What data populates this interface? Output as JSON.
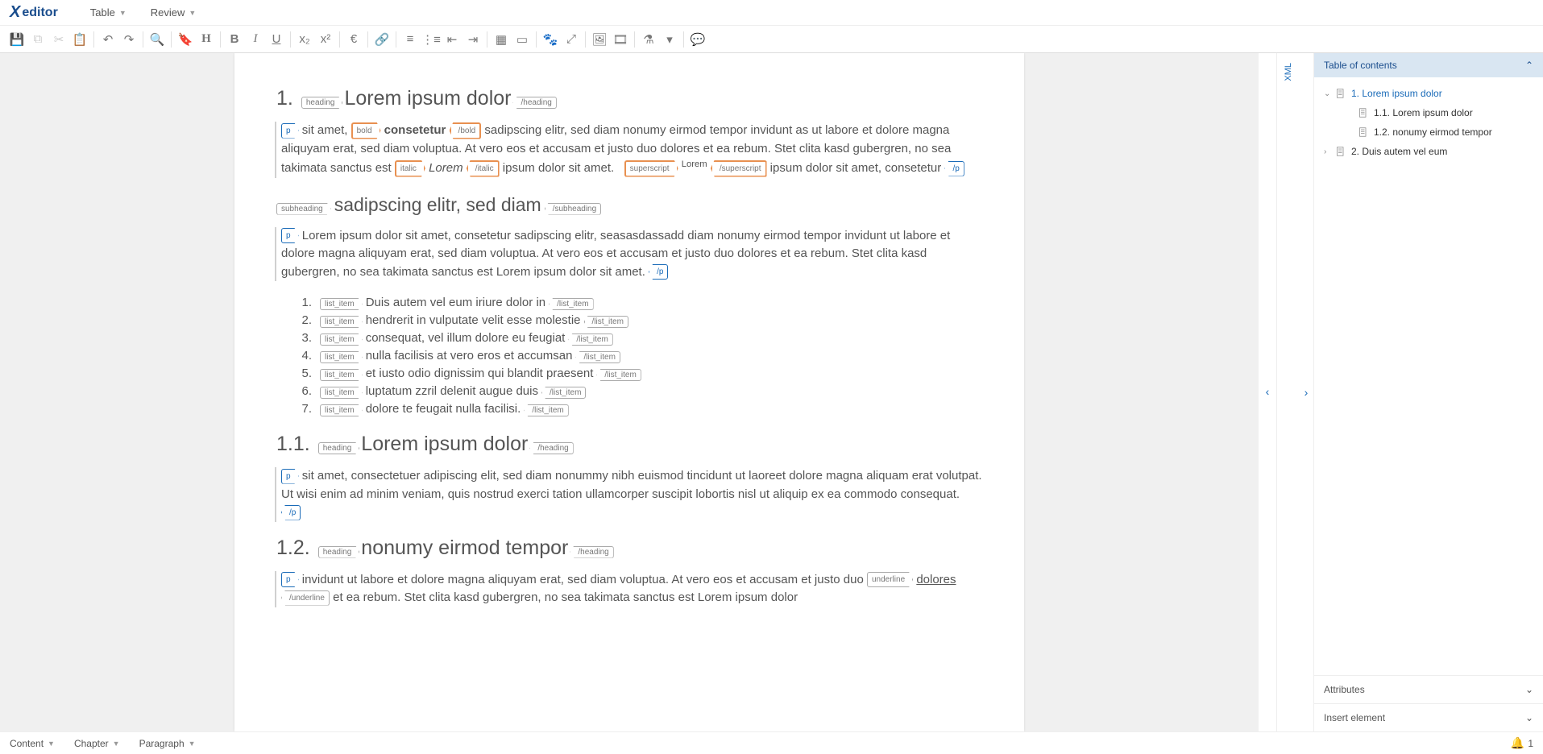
{
  "logo": {
    "prefix": "X",
    "text": "editor"
  },
  "menus": [
    {
      "label": "Table"
    },
    {
      "label": "Review"
    }
  ],
  "toolbar_groups": [
    [
      {
        "icon": "save",
        "faded": false
      },
      {
        "icon": "copy",
        "faded": true
      },
      {
        "icon": "cut",
        "faded": true
      },
      {
        "icon": "paste",
        "faded": false
      }
    ],
    [
      {
        "icon": "undo",
        "faded": false
      },
      {
        "icon": "redo",
        "faded": false
      }
    ],
    [
      {
        "icon": "search",
        "faded": false
      }
    ],
    [
      {
        "icon": "bookmark",
        "faded": false
      },
      {
        "icon": "heading",
        "faded": false
      }
    ],
    [
      {
        "icon": "bold",
        "faded": false
      },
      {
        "icon": "italic",
        "faded": false
      },
      {
        "icon": "underline",
        "faded": false
      }
    ],
    [
      {
        "icon": "subscript",
        "faded": false
      },
      {
        "icon": "superscript",
        "faded": false
      }
    ],
    [
      {
        "icon": "euro",
        "faded": false
      }
    ],
    [
      {
        "icon": "link",
        "faded": false
      }
    ],
    [
      {
        "icon": "ol",
        "faded": false
      },
      {
        "icon": "ul",
        "faded": false
      },
      {
        "icon": "indent",
        "faded": false
      },
      {
        "icon": "outdent",
        "faded": false
      }
    ],
    [
      {
        "icon": "table",
        "faded": false
      },
      {
        "icon": "rect",
        "faded": false
      }
    ],
    [
      {
        "icon": "paw",
        "faded": false
      },
      {
        "icon": "expand",
        "faded": false
      }
    ],
    [
      {
        "icon": "image",
        "faded": false
      },
      {
        "icon": "video",
        "faded": false
      }
    ],
    [
      {
        "icon": "flask",
        "faded": false
      },
      {
        "icon": "caret",
        "faded": false
      }
    ],
    [
      {
        "icon": "comment",
        "faded": false
      }
    ]
  ],
  "doc": {
    "s1": {
      "num": "1.",
      "tag": "heading",
      "title": "Lorem ipsum dolor",
      "p1": {
        "pre_bold": "sit amet,",
        "bold_tag": "bold",
        "bold_text": "consetetur",
        "after_bold": "sadipscing elitr, sed diam nonumy eirmod tempor invidunt as ut  labore et dolore magna aliquyam erat, sed diam voluptua. At vero eos et accusam et justo duo dolores et ea rebum. Stet clita kasd gubergren, no sea takimata sanctus est",
        "italic_tag": "italic",
        "italic_text": "Lorem",
        "after_italic": "ipsum dolor sit amet.",
        "sup_tag": "superscript",
        "sup_text": "Lorem",
        "after_sup": "ipsum dolor sit amet, consetetur"
      },
      "sub": {
        "tag": "subheading",
        "title": "sadipscing elitr, sed diam"
      },
      "p2": "Lorem ipsum dolor sit amet, consetetur sadipscing elitr, seasasdassadd  diam nonumy eirmod tempor invidunt ut labore et dolore magna aliquyam erat, sed diam voluptua. At vero eos et accusam et justo duo dolores et ea rebum. Stet clita kasd gubergren, no sea takimata sanctus est Lorem ipsum dolor sit amet.",
      "list_tag": "list_item",
      "list": [
        "Duis autem vel eum iriure dolor in",
        "hendrerit in vulputate velit esse molestie",
        "consequat, vel illum dolore eu feugiat",
        "nulla facilisis at vero eros et accumsan",
        "et iusto odio dignissim qui blandit praesent",
        "luptatum zzril delenit augue duis",
        "dolore te feugait nulla facilisi."
      ]
    },
    "s1_1": {
      "num": "1.1.",
      "tag": "heading",
      "title": "Lorem ipsum dolor",
      "p": "sit amet, consectetuer adipiscing elit, sed diam nonummy nibh euismod tincidunt ut laoreet dolore magna aliquam erat volutpat. Ut wisi enim ad minim veniam, quis nostrud exerci tation ullamcorper suscipit lobortis nisl ut aliquip ex ea commodo consequat."
    },
    "s1_2": {
      "num": "1.2.",
      "tag": "heading",
      "title": "nonumy eirmod tempor",
      "p_pre": "invidunt ut labore et dolore magna aliquyam erat, sed diam voluptua. At vero eos et accusam et justo duo",
      "u_tag": "underline",
      "u_text": "dolores",
      "p_post": "et ea rebum. Stet clita kasd gubergren, no sea takimata sanctus est Lorem ipsum dolor"
    }
  },
  "xml_tab": "XML",
  "sidebar": {
    "toc_title": "Table of contents",
    "toc": [
      {
        "label": "1. Lorem ipsum dolor",
        "active": true,
        "level": 0,
        "expanded": true
      },
      {
        "label": "1.1. Lorem ipsum dolor",
        "active": false,
        "level": 1
      },
      {
        "label": "1.2. nonumy eirmod tempor",
        "active": false,
        "level": 1
      },
      {
        "label": "2. Duis autem vel eum",
        "active": false,
        "level": 0,
        "expanded": false
      }
    ],
    "attributes": "Attributes",
    "insert": "Insert element"
  },
  "status": {
    "items": [
      "Content",
      "Chapter",
      "Paragraph"
    ],
    "notif_count": "1"
  }
}
